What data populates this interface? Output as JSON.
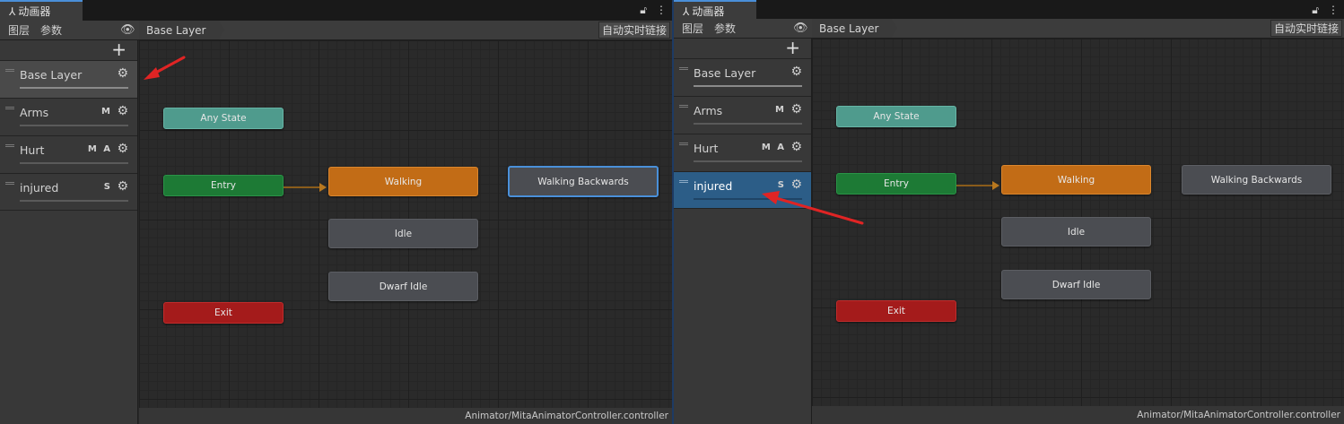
{
  "window": {
    "tab_title": "动画器",
    "tab_icon": "animator-icon",
    "lock_icon": "lock-icon",
    "menu_icon": "kebab-menu-icon"
  },
  "toolbar": {
    "layers_tab": "图层",
    "params_tab": "参数",
    "breadcrumb": "Base Layer",
    "autolink_button": "自动实时链接"
  },
  "layers": [
    {
      "name": "Base Layer",
      "flags": ""
    },
    {
      "name": "Arms",
      "flags": "M"
    },
    {
      "name": "Hurt",
      "flags": "M A"
    },
    {
      "name": "injured",
      "flags": "S"
    }
  ],
  "states": {
    "any_state": "Any State",
    "entry": "Entry",
    "exit": "Exit",
    "walking": "Walking",
    "walking_backwards": "Walking Backwards",
    "idle": "Idle",
    "dwarf_idle": "Dwarf Idle"
  },
  "status": {
    "path": "Animator/MitaAnimatorController.controller"
  },
  "colors": {
    "accent": "#4a8fd8",
    "selected_layer": "#2c5d87",
    "annotation_arrow": "#e02424",
    "state_default": "#c26c16",
    "any_state": "#4f9b8d",
    "entry": "#1d7a35",
    "exit": "#a41b1b"
  }
}
